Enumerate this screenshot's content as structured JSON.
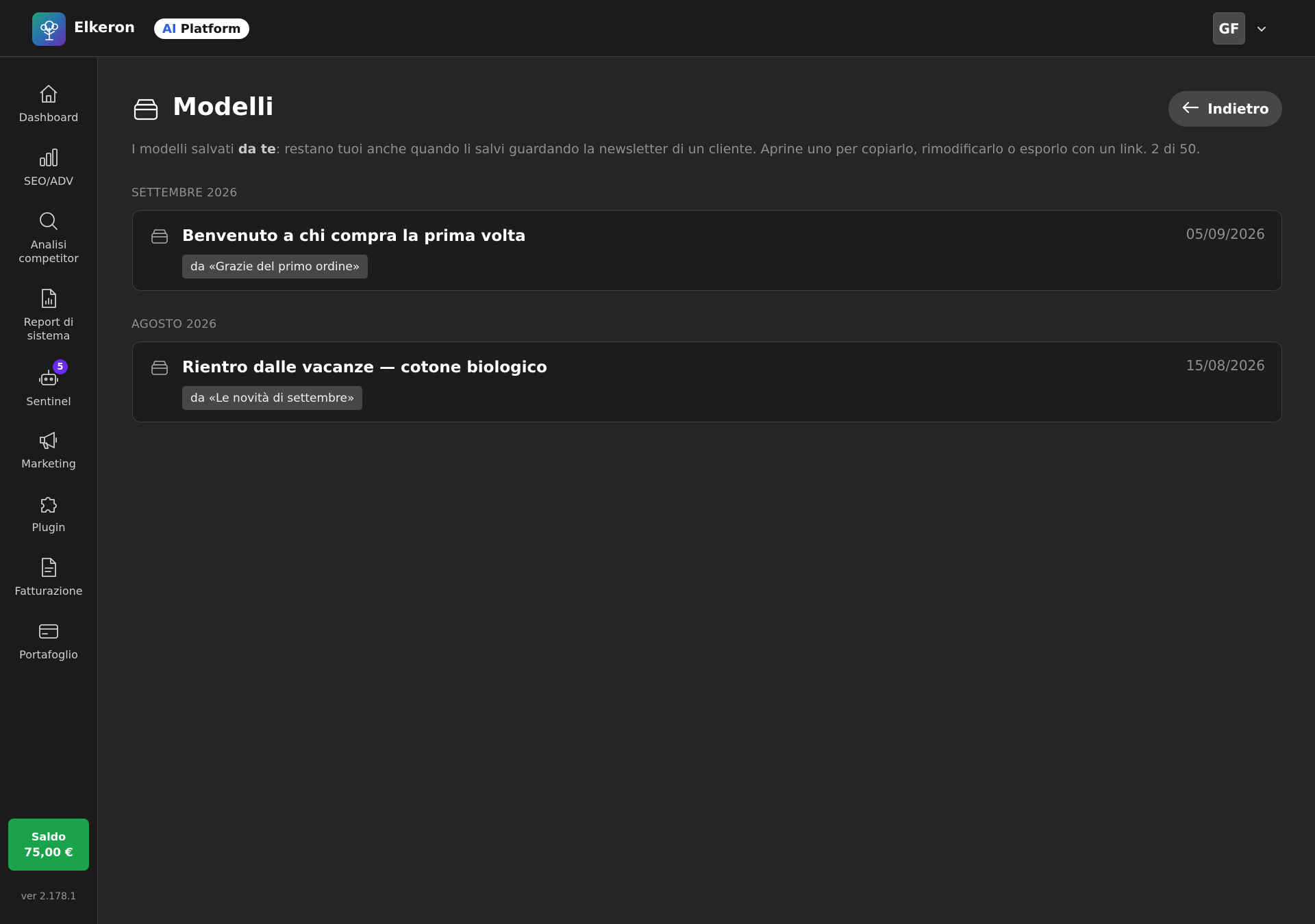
{
  "header": {
    "brand": "Elkeron",
    "pill_ai": "AI",
    "pill_platform": "Platform",
    "avatar_initials": "GF"
  },
  "sidebar": {
    "items": [
      {
        "label": "Dashboard",
        "icon": "home-icon"
      },
      {
        "label": "SEO/ADV",
        "icon": "bar-chart-icon"
      },
      {
        "label": "Analisi competitor",
        "icon": "search-icon"
      },
      {
        "label": "Report di sistema",
        "icon": "report-file-icon"
      },
      {
        "label": "Sentinel",
        "icon": "robot-icon",
        "badge": "5"
      },
      {
        "label": "Marketing",
        "icon": "megaphone-icon"
      },
      {
        "label": "Plugin",
        "icon": "puzzle-icon"
      },
      {
        "label": "Fatturazione",
        "icon": "invoice-file-icon"
      },
      {
        "label": "Portafoglio",
        "icon": "credit-card-icon"
      }
    ],
    "balance_label": "Saldo",
    "balance_value": "75,00 €",
    "version": "ver 2.178.1"
  },
  "main": {
    "title": "Modelli",
    "back_label": "Indietro",
    "intro_before": "I modelli salvati ",
    "intro_bold": "da te",
    "intro_after": ": restano tuoi anche quando li salvi guardando la newsletter di un cliente. Aprine uno per copiarlo, rimodificarlo o esporlo con un link. 2 di 50.",
    "sections": [
      {
        "label": "SETTEMBRE 2026",
        "items": [
          {
            "title": "Benvenuto a chi compra la prima volta",
            "source": "da «Grazie del primo ordine»",
            "date": "05/09/2026"
          }
        ]
      },
      {
        "label": "AGOSTO 2026",
        "items": [
          {
            "title": "Rientro dalle vacanze — cotone biologico",
            "source": "da «Le novità di settembre»",
            "date": "15/08/2026"
          }
        ]
      }
    ]
  },
  "colors": {
    "background": "#252525",
    "topbar": "#1b1b1b",
    "accent_purple": "#6a2cf0",
    "balance_green": "#1aa34a",
    "ai_blue": "#2a62e0"
  }
}
